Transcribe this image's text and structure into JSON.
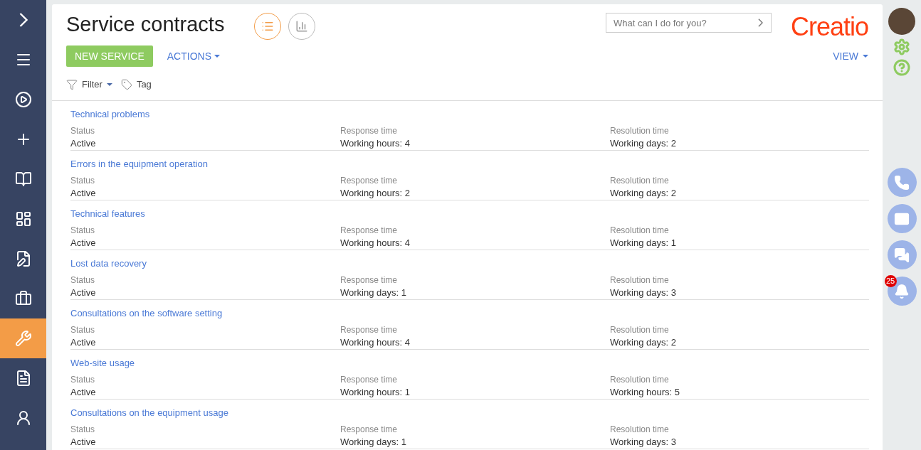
{
  "sidebar": {
    "items": [
      {
        "kind": "expand",
        "selected": false
      },
      {
        "kind": "menu",
        "selected": false
      },
      {
        "kind": "play",
        "selected": false
      },
      {
        "kind": "add",
        "selected": false
      },
      {
        "kind": "book",
        "selected": false
      },
      {
        "kind": "dashboard",
        "selected": false
      },
      {
        "kind": "edit",
        "selected": false
      },
      {
        "kind": "briefcases",
        "selected": false
      },
      {
        "kind": "service",
        "selected": true
      },
      {
        "kind": "document",
        "selected": false
      },
      {
        "kind": "user",
        "selected": false
      }
    ]
  },
  "header": {
    "title": "Service contracts",
    "view_toggles": [
      {
        "kind": "list",
        "selected": true
      },
      {
        "kind": "chart",
        "selected": false
      }
    ],
    "search": {
      "placeholder": "What can I do for you?"
    },
    "logo": "Creatio"
  },
  "toolbar": {
    "primary_button": "NEW SERVICE",
    "actions": "ACTIONS",
    "view": "VIEW"
  },
  "filters": {
    "filter": "Filter",
    "tag": "Tag"
  },
  "records": [
    {
      "title": "Technical problems",
      "fields": [
        {
          "label": "Status",
          "value": "Active"
        },
        {
          "label": "Response time",
          "value": "Working hours: 4"
        },
        {
          "label": "Resolution time",
          "value": "Working days: 2"
        }
      ]
    },
    {
      "title": "Errors in the equipment operation",
      "fields": [
        {
          "label": "Status",
          "value": "Active"
        },
        {
          "label": "Response time",
          "value": "Working hours: 2"
        },
        {
          "label": "Resolution time",
          "value": "Working days: 2"
        }
      ]
    },
    {
      "title": "Technical features",
      "fields": [
        {
          "label": "Status",
          "value": "Active"
        },
        {
          "label": "Response time",
          "value": "Working hours: 4"
        },
        {
          "label": "Resolution time",
          "value": "Working days: 1"
        }
      ]
    },
    {
      "title": "Lost data recovery",
      "fields": [
        {
          "label": "Status",
          "value": "Active"
        },
        {
          "label": "Response time",
          "value": "Working days: 1"
        },
        {
          "label": "Resolution time",
          "value": "Working days: 3"
        }
      ]
    },
    {
      "title": "Consultations on the software setting",
      "fields": [
        {
          "label": "Status",
          "value": "Active"
        },
        {
          "label": "Response time",
          "value": "Working hours: 4"
        },
        {
          "label": "Resolution time",
          "value": "Working days: 2"
        }
      ]
    },
    {
      "title": "Web-site usage",
      "fields": [
        {
          "label": "Status",
          "value": "Active"
        },
        {
          "label": "Response time",
          "value": "Working hours: 1"
        },
        {
          "label": "Resolution time",
          "value": "Working hours: 5"
        }
      ]
    },
    {
      "title": "Consultations on the equipment usage",
      "fields": [
        {
          "label": "Status",
          "value": "Active"
        },
        {
          "label": "Response time",
          "value": "Working days: 1"
        },
        {
          "label": "Resolution time",
          "value": "Working days: 3"
        }
      ]
    }
  ],
  "right_rail": {
    "actions": [
      {
        "kind": "phone"
      },
      {
        "kind": "email"
      },
      {
        "kind": "chat"
      },
      {
        "kind": "notifications",
        "badge": "25"
      }
    ]
  }
}
